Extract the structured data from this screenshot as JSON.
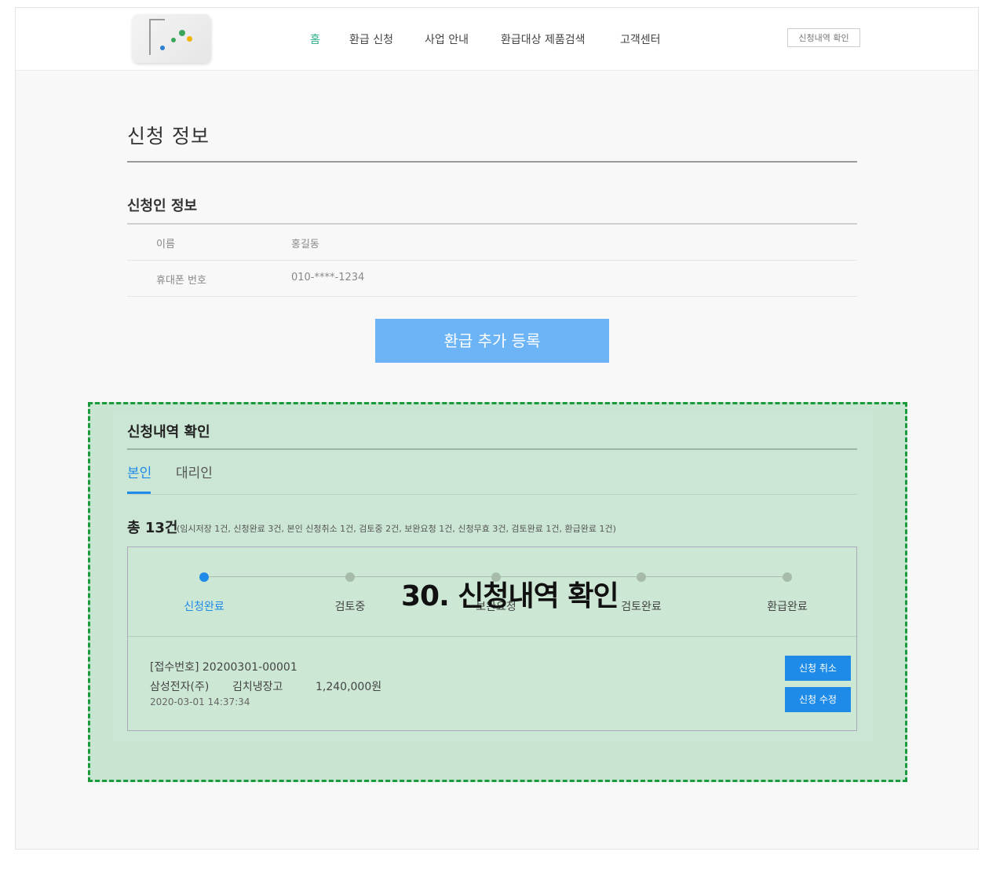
{
  "header": {
    "nav": [
      "홈",
      "환급 신청",
      "사업 안내",
      "환급대상 제품검색",
      "고객센터"
    ],
    "history_button": "신청내역 확인"
  },
  "page": {
    "title": "신청 정보",
    "applicant": {
      "title": "신청인 정보",
      "rows": [
        {
          "label": "이름",
          "value": "홍길동"
        },
        {
          "label": "휴대폰 번호",
          "value": "010-****-1234"
        }
      ]
    },
    "add_button": "환급 추가 등록"
  },
  "history": {
    "title": "신청내역 확인",
    "tabs": [
      "본인",
      "대리인"
    ],
    "total": "총 13건",
    "total_detail": "(임시저장 1건, 신청완료 3건, 본인 신청취소 1건, 검토중 2건, 보완요청 1건, 신청무효 3건, 검토완료 1건, 환급완료 1건)",
    "steps": [
      "신청완료",
      "검토중",
      "보완요청",
      "검토완료",
      "환급완료"
    ],
    "record": {
      "receipt": "[접수번호] 20200301-00001",
      "maker": "삼성전자(주)",
      "product": "김치냉장고",
      "amount": "1,240,000원",
      "datetime": "2020-03-01 14:37:34"
    },
    "buttons": {
      "cancel": "신청 취소",
      "edit": "신청 수정"
    }
  },
  "annotation": "30. 신청내역 확인",
  "colors": {
    "accent": "#1f8be8",
    "nav_active": "#2cae8a",
    "add_button": "#6db4f7",
    "highlight": "#c8e5d2",
    "highlight_border": "#1a9a3a"
  }
}
